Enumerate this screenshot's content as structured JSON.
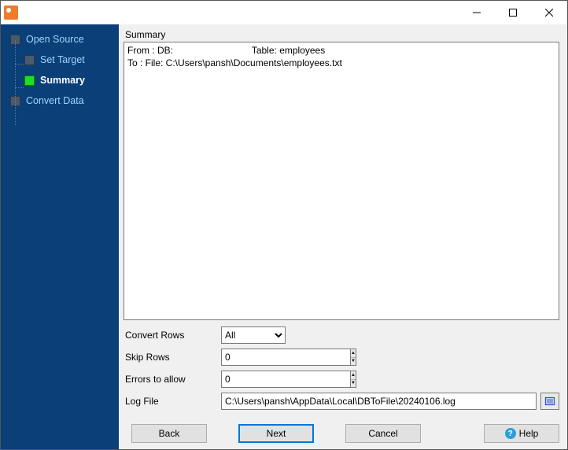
{
  "window": {
    "title": ""
  },
  "sidebar": {
    "steps": [
      {
        "label": "Open Source",
        "active": false,
        "indent": false
      },
      {
        "label": "Set Target",
        "active": false,
        "indent": true
      },
      {
        "label": "Summary",
        "active": true,
        "indent": true
      },
      {
        "label": "Convert Data",
        "active": false,
        "indent": false
      }
    ]
  },
  "summary": {
    "heading": "Summary",
    "line_from_prefix": "From : DB:",
    "line_from_table_label": "Table:",
    "line_from_table_value": "employees",
    "line_to": "To : File: C:\\Users\\pansh\\Documents\\employees.txt"
  },
  "form": {
    "convert_rows_label": "Convert Rows",
    "convert_rows_value": "All",
    "skip_rows_label": "Skip Rows",
    "skip_rows_value": "0",
    "errors_label": "Errors to allow",
    "errors_value": "0",
    "logfile_label": "Log File",
    "logfile_value": "C:\\Users\\pansh\\AppData\\Local\\DBToFile\\20240106.log"
  },
  "buttons": {
    "back": "Back",
    "next": "Next",
    "cancel": "Cancel",
    "help": "Help"
  }
}
